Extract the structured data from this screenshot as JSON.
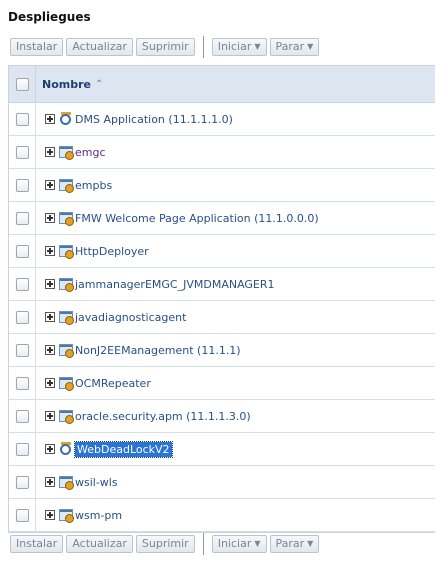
{
  "page": {
    "title": "Despliegues"
  },
  "toolbar": {
    "buttons": [
      "Instalar",
      "Actualizar",
      "Suprimir"
    ],
    "menus": [
      "Iniciar",
      "Parar"
    ]
  },
  "table": {
    "header": "Nombre",
    "rows": [
      {
        "name": "DMS Application (11.1.1.1.0)",
        "icon": "deployment-app-icon",
        "state": "normal"
      },
      {
        "name": "emgc",
        "icon": "web-module-icon",
        "state": "visited"
      },
      {
        "name": "empbs",
        "icon": "web-module-icon",
        "state": "normal"
      },
      {
        "name": "FMW Welcome Page Application (11.1.0.0.0)",
        "icon": "web-module-icon",
        "state": "normal"
      },
      {
        "name": "HttpDeployer",
        "icon": "web-module-icon",
        "state": "normal"
      },
      {
        "name": "jammanagerEMGC_JVMDMANAGER1",
        "icon": "web-module-icon",
        "state": "normal"
      },
      {
        "name": "javadiagnosticagent",
        "icon": "web-module-icon",
        "state": "normal"
      },
      {
        "name": "NonJ2EEManagement (11.1.1)",
        "icon": "web-module-icon",
        "state": "normal"
      },
      {
        "name": "OCMRepeater",
        "icon": "web-module-icon",
        "state": "normal"
      },
      {
        "name": "oracle.security.apm (11.1.1.3.0)",
        "icon": "web-module-icon",
        "state": "normal"
      },
      {
        "name": "WebDeadLockV2",
        "icon": "deployment-app-icon",
        "state": "selected"
      },
      {
        "name": "wsil-wls",
        "icon": "web-module-icon",
        "state": "normal"
      },
      {
        "name": "wsm-pm",
        "icon": "web-module-icon",
        "state": "normal"
      }
    ]
  }
}
